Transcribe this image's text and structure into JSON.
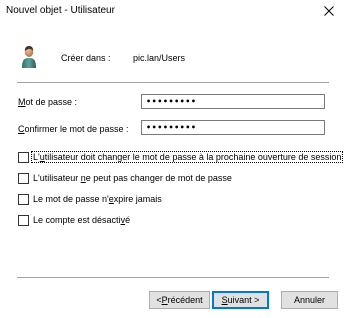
{
  "window": {
    "title": "Nouvel objet - Utilisateur",
    "close_glyph": "close-icon"
  },
  "header": {
    "icon": "user-icon",
    "create_label": "Créer dans :",
    "create_path": "pic.lan/Users"
  },
  "form": {
    "password": {
      "label_underlined": "M",
      "label_rest": "ot de passe :",
      "value": "•••••••••"
    },
    "confirm": {
      "label_underlined": "C",
      "label_rest": "onfirmer le mot de passe :",
      "value": "•••••••••"
    }
  },
  "options": [
    {
      "label_before": "L'",
      "label_underlined": "u",
      "label_after": "tilisateur doit changer le mot de passe à la prochaine ouverture de session",
      "checked": false,
      "focused": true
    },
    {
      "label_before": "L'utilisateur ",
      "label_underlined": "n",
      "label_after": "e peut pas changer de mot de passe",
      "checked": false,
      "focused": false
    },
    {
      "label_before": "Le mot de passe n'",
      "label_underlined": "e",
      "label_after": "xpire jamais",
      "checked": false,
      "focused": false
    },
    {
      "label_before": "Le compte est désacti",
      "label_underlined": "v",
      "label_after": "é",
      "checked": false,
      "focused": false
    }
  ],
  "buttons": {
    "previous": {
      "before": "< ",
      "underlined": "P",
      "after": "récédent"
    },
    "next": {
      "before": "",
      "underlined": "S",
      "after": "uivant >"
    },
    "cancel": {
      "label": "Annuler"
    }
  }
}
